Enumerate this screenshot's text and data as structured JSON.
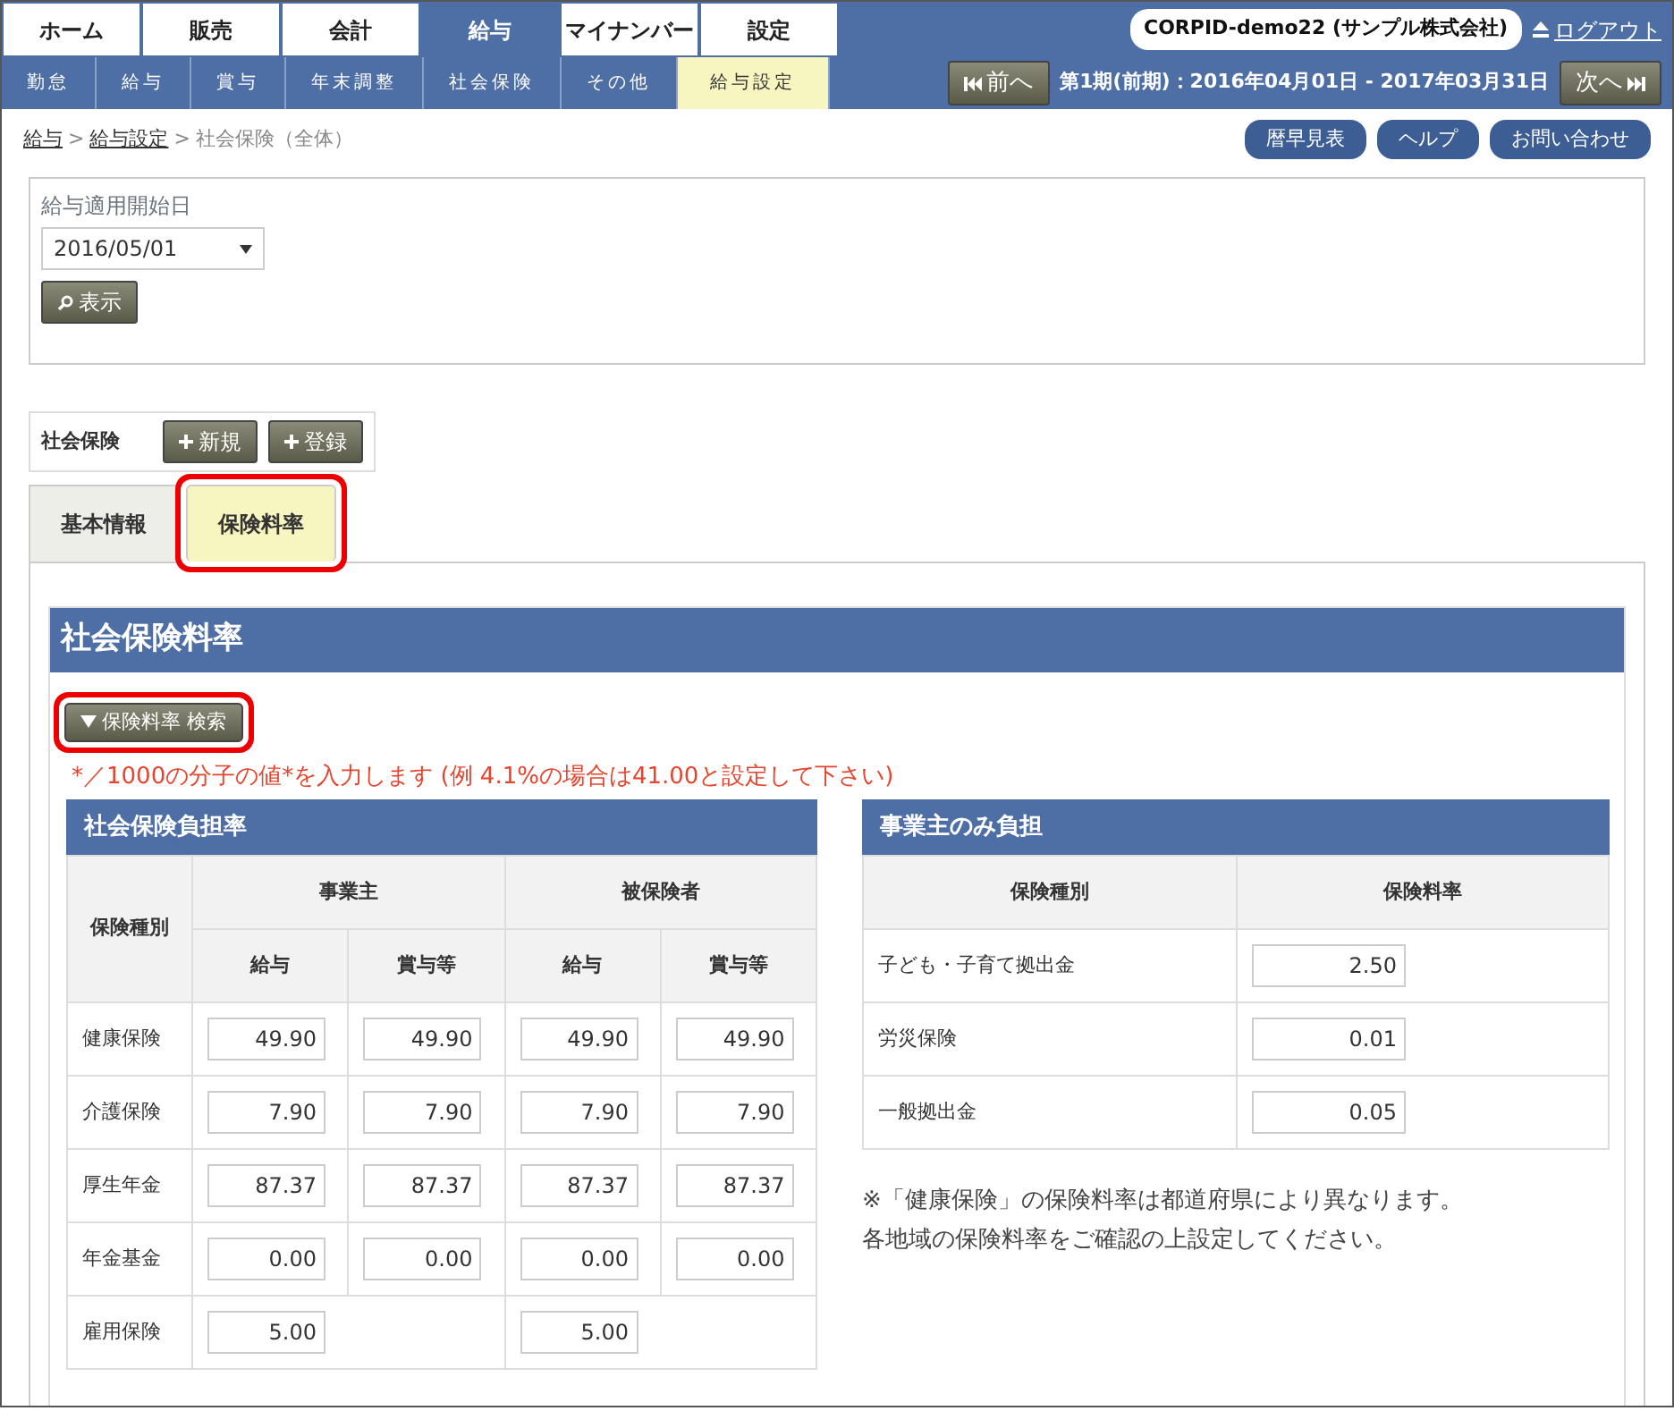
{
  "top_nav": [
    {
      "label": "ホーム",
      "selected": false
    },
    {
      "label": "販売",
      "selected": false
    },
    {
      "label": "会計",
      "selected": false
    },
    {
      "label": "給与",
      "selected": true
    },
    {
      "label": "マイナンバー",
      "selected": false
    },
    {
      "label": "設定",
      "selected": false
    }
  ],
  "sub_nav": [
    {
      "label": "勤怠",
      "selected": false
    },
    {
      "label": "給与",
      "selected": false
    },
    {
      "label": "賞与",
      "selected": false
    },
    {
      "label": "年末調整",
      "selected": false
    },
    {
      "label": "社会保険",
      "selected": false
    },
    {
      "label": "その他",
      "selected": false
    },
    {
      "label": "給与設定",
      "selected": true
    }
  ],
  "company": "CORPID-demo22 (サンプル株式会社)",
  "logout": "ログアウト",
  "period": {
    "prev": "前へ",
    "label": "第1期(前期)：2016年04月01日 - 2017年03月31日",
    "next": "次へ"
  },
  "breadcrumb_separator": ">",
  "breadcrumb": [
    {
      "label": "給与",
      "link": true
    },
    {
      "label": "給与設定",
      "link": true
    },
    {
      "label": "社会保険（全体）",
      "link": false
    }
  ],
  "help_buttons": [
    "暦早見表",
    "ヘルプ",
    "お問い合わせ"
  ],
  "filter": {
    "label": "給与適用開始日",
    "value": "2016/05/01",
    "button": "表示"
  },
  "record_bar": {
    "title": "社会保険",
    "buttons": [
      "新規",
      "登録"
    ]
  },
  "tabs": [
    {
      "label": "基本情報",
      "selected": false,
      "highlighted": false
    },
    {
      "label": "保険料率",
      "selected": true,
      "highlighted": true
    }
  ],
  "section": {
    "title": "社会保険料率",
    "search_button": {
      "label": "保険料率 検索",
      "highlighted": true
    },
    "note": "*／1000の分子の値*を入力します (例 4.1%の場合は41.00と設定して下さい)"
  },
  "burden_table": {
    "title": "社会保険負担率",
    "row_header": "保険種別",
    "group_headers": [
      "事業主",
      "被保険者"
    ],
    "sub_headers": [
      "給与",
      "賞与等",
      "給与",
      "賞与等"
    ],
    "rows": [
      {
        "label": "健康保険",
        "values": [
          "49.90",
          "49.90",
          "49.90",
          "49.90"
        ]
      },
      {
        "label": "介護保険",
        "values": [
          "7.90",
          "7.90",
          "7.90",
          "7.90"
        ]
      },
      {
        "label": "厚生年金",
        "values": [
          "87.37",
          "87.37",
          "87.37",
          "87.37"
        ]
      },
      {
        "label": "年金基金",
        "values": [
          "0.00",
          "0.00",
          "0.00",
          "0.00"
        ]
      },
      {
        "label": "雇用保険",
        "values": [
          "5.00",
          "5.00"
        ]
      }
    ]
  },
  "employer_table": {
    "title": "事業主のみ負担",
    "columns": [
      "保険種別",
      "保険料率"
    ],
    "rows": [
      {
        "label": "子ども・子育て拠出金",
        "value": "2.50"
      },
      {
        "label": "労災保険",
        "value": "0.01"
      },
      {
        "label": "一般拠出金",
        "value": "0.05"
      }
    ]
  },
  "footnote": [
    "※「健康保険」の保険料率は都道府県により異なります。",
    "各地域の保険料率をご確認の上設定してください。"
  ]
}
